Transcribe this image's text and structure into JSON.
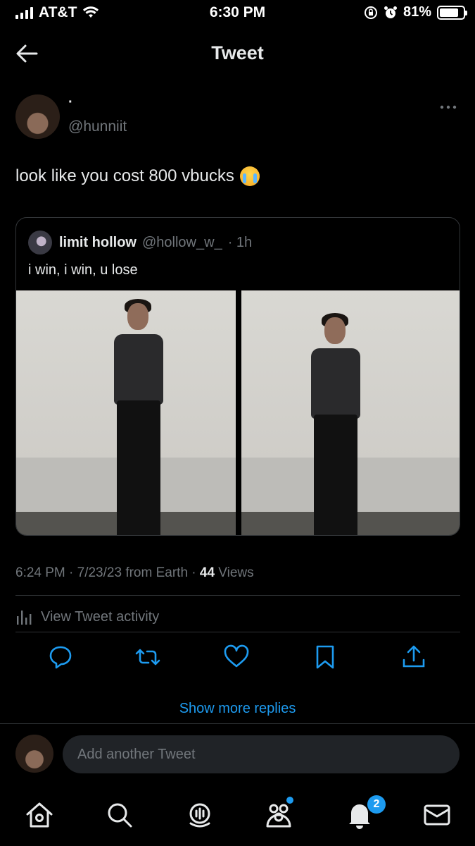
{
  "status_bar": {
    "carrier": "AT&T",
    "time": "6:30 PM",
    "battery": "81%",
    "battery_level": 0.81
  },
  "header": {
    "title": "Tweet"
  },
  "tweet": {
    "author_name": "·",
    "author_handle": "@hunniit",
    "text": "look like you cost 800 vbucks",
    "emoji": "loudly-crying-face",
    "quote": {
      "name": "limit hollow",
      "handle": "@hollow_w_",
      "time": "· 1h",
      "text": "i win, i win, u lose"
    },
    "meta": {
      "timestamp": "6:24 PM · 7/23/23 from Earth · ",
      "views_count": "44",
      "views_label": " Views"
    },
    "activity_label": "View Tweet activity"
  },
  "show_more": "Show more replies",
  "compose": {
    "placeholder": "Add another Tweet"
  },
  "tabbar": {
    "notifications_badge": "2"
  },
  "colors": {
    "accent": "#1d9bf0",
    "background": "#000000",
    "muted": "#71767b"
  }
}
